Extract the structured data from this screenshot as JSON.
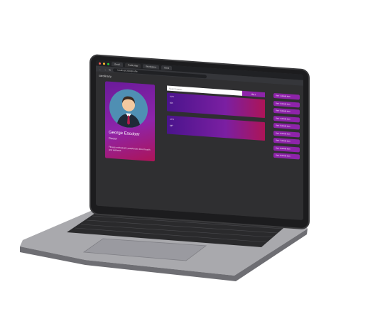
{
  "browser": {
    "tabs": [
      "Gmail",
      "Profile App",
      "Workspace",
      "Docs"
    ],
    "url": "localhost:3000/profile",
    "window_controls": [
      "close",
      "minimize",
      "maximize"
    ]
  },
  "app": {
    "brand": "carolina.ly"
  },
  "profile": {
    "name": "George Escobar",
    "role": "Doctor",
    "bio": "Fitness enthusiast | passionate about health and wellness"
  },
  "search": {
    "placeholder": "Search users...",
    "button_label": "GET"
  },
  "results": [
    {
      "title": "MAY",
      "sub": "MX"
    },
    {
      "title": "APR",
      "sub": "MP"
    }
  ],
  "side_list": [
    "User 1 details item",
    "User 2 details item",
    "User 3 details item",
    "User 4 details item",
    "User 5 details item",
    "User 6 details item",
    "User 7 details item",
    "User 8 details item",
    "User 9 details item"
  ],
  "colors": {
    "accent": "#8e24aa",
    "accent_dark": "#4a148c",
    "accent_pink": "#ad1457",
    "page_bg": "#2f2f31",
    "laptop_frame": "#1c1c1e",
    "laptop_base": "#8e8e93"
  },
  "icons": {
    "avatar": "person-avatar-icon",
    "laptop": "laptop-device"
  }
}
